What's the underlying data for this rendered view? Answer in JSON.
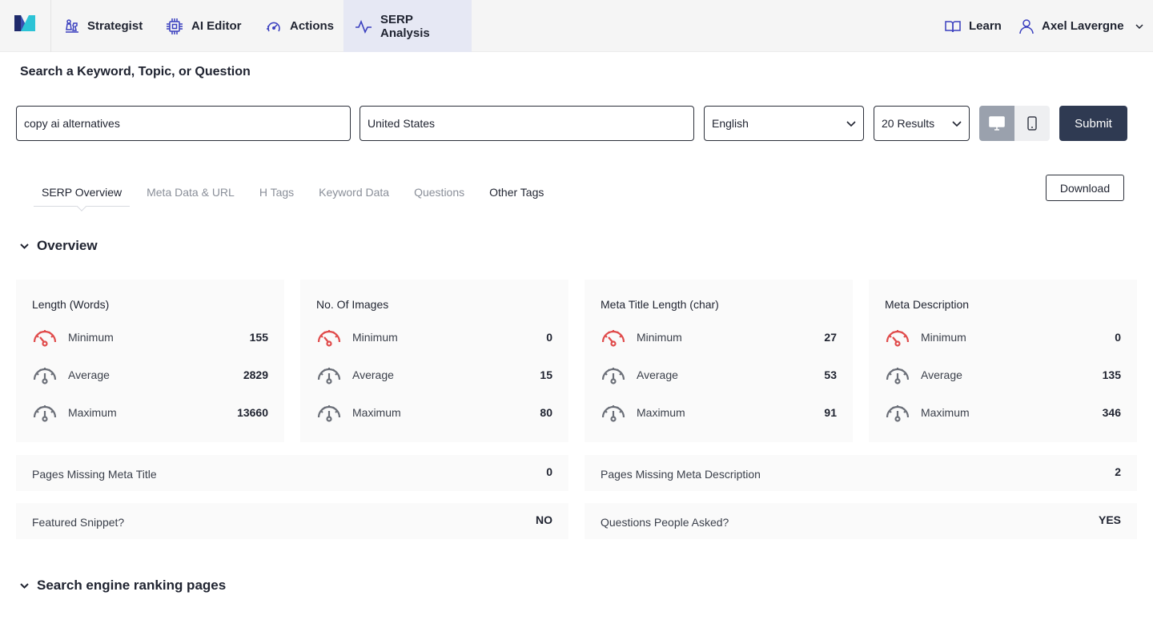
{
  "nav": {
    "items": [
      {
        "label": "Strategist",
        "icon": "chess-icon"
      },
      {
        "label": "AI Editor",
        "icon": "chip-icon"
      },
      {
        "label": "Actions",
        "icon": "speed-icon"
      },
      {
        "label": "SERP Analysis",
        "icon": "pulse-icon"
      }
    ],
    "learn_label": "Learn",
    "user_name": "Axel Lavergne"
  },
  "search": {
    "heading": "Search a Keyword, Topic, or Question",
    "keyword_value": "copy ai alternatives",
    "location_value": "United States",
    "language_value": "English",
    "results_value": "20 Results",
    "submit_label": "Submit"
  },
  "tabs": [
    "SERP Overview",
    "Meta Data & URL",
    "H Tags",
    "Keyword Data",
    "Questions",
    "Other Tags"
  ],
  "download_label": "Download",
  "overview": {
    "title": "Overview",
    "cards": [
      {
        "title": "Length (Words)",
        "rows": [
          {
            "label": "Minimum",
            "value": "155"
          },
          {
            "label": "Average",
            "value": "2829"
          },
          {
            "label": "Maximum",
            "value": "13660"
          }
        ]
      },
      {
        "title": "No. Of Images",
        "rows": [
          {
            "label": "Minimum",
            "value": "0"
          },
          {
            "label": "Average",
            "value": "15"
          },
          {
            "label": "Maximum",
            "value": "80"
          }
        ]
      },
      {
        "title": "Meta Title Length (char)",
        "rows": [
          {
            "label": "Minimum",
            "value": "27"
          },
          {
            "label": "Average",
            "value": "53"
          },
          {
            "label": "Maximum",
            "value": "91"
          }
        ]
      },
      {
        "title": "Meta Description",
        "rows": [
          {
            "label": "Minimum",
            "value": "0"
          },
          {
            "label": "Average",
            "value": "135"
          },
          {
            "label": "Maximum",
            "value": "346"
          }
        ]
      }
    ],
    "summary": [
      {
        "label": "Pages Missing Meta Title",
        "value": "0"
      },
      {
        "label": "Pages Missing Meta Description",
        "value": "2"
      },
      {
        "label": "Featured Snippet?",
        "value": "NO"
      },
      {
        "label": "Questions People Asked?",
        "value": "YES"
      }
    ]
  },
  "ranking_section_title": "Search engine ranking pages",
  "colors": {
    "accent": "#2f3a52",
    "nav_active": "#e6e8f4",
    "gauge_min": "#e04b4b",
    "gauge": "#6b6f78",
    "icon_blue": "#3a3fbf"
  }
}
